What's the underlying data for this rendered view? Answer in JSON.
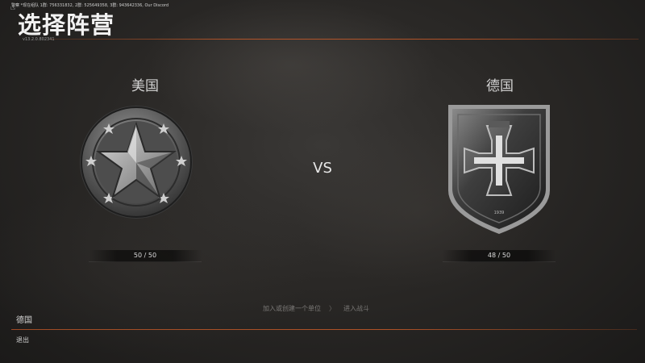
{
  "header": {
    "top_info": "警察 *现在组队 1群: 756331832, 2群: 525649358, 3群: 943642336, Our Discord",
    "brand": "LS",
    "title": "选择阵营",
    "version": "v13.2.0.802341"
  },
  "factions": {
    "left": {
      "name": "美国",
      "count": "50 / 50",
      "icon": "star-emblem-icon"
    },
    "right": {
      "name": "德国",
      "count": "48 / 50",
      "icon": "iron-cross-shield-icon"
    }
  },
  "vs_label": "VS",
  "hints": {
    "join_or_create": "加入或创建一个单位",
    "arrow": "〉",
    "enter_battle": "进入战斗"
  },
  "footer": {
    "selected_faction": "德国",
    "exit_label": "退出"
  },
  "colors": {
    "accent_line": "#c85a28",
    "background": "#2a2826"
  }
}
